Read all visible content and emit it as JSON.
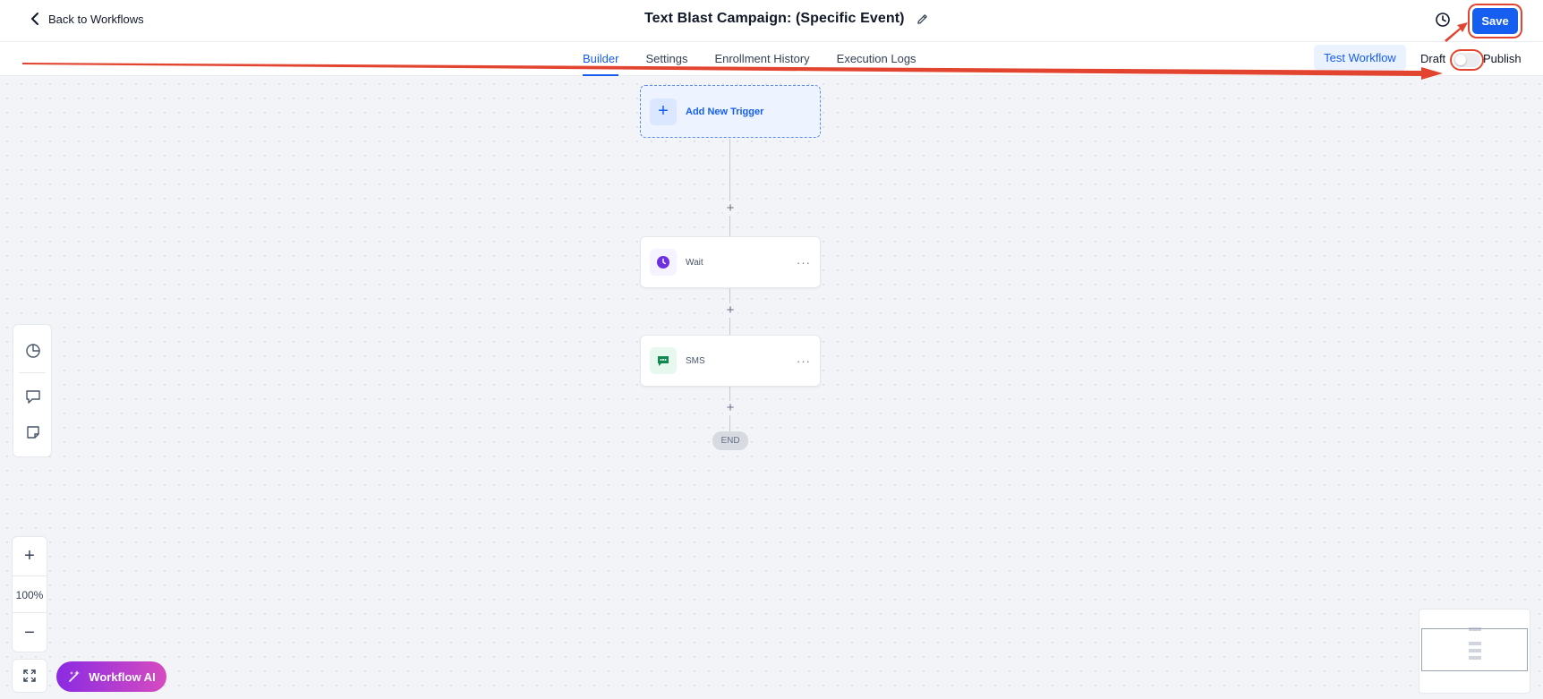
{
  "header": {
    "back_label": "Back to Workflows",
    "title": "Text Blast Campaign: (Specific Event)",
    "save_label": "Save"
  },
  "tabs": [
    {
      "label": "Builder",
      "active": true
    },
    {
      "label": "Settings",
      "active": false
    },
    {
      "label": "Enrollment History",
      "active": false
    },
    {
      "label": "Execution Logs",
      "active": false
    }
  ],
  "actions": {
    "test_label": "Test Workflow",
    "draft_label": "Draft",
    "publish_label": "Publish",
    "published": false
  },
  "workflow": {
    "trigger_label": "Add New Trigger",
    "steps": [
      {
        "name": "Wait",
        "icon": "clock-icon",
        "color": "#6d2fe0"
      },
      {
        "name": "SMS",
        "icon": "chat-icon",
        "color": "#0f8a4f"
      }
    ],
    "end_label": "END"
  },
  "canvas": {
    "zoom_level": "100%"
  },
  "ai": {
    "label": "Workflow AI"
  },
  "colors": {
    "primary": "#155eef",
    "annotation": "#e2442f",
    "ai_gradient_start": "#8a2be2",
    "ai_gradient_end": "#d64bc0"
  }
}
